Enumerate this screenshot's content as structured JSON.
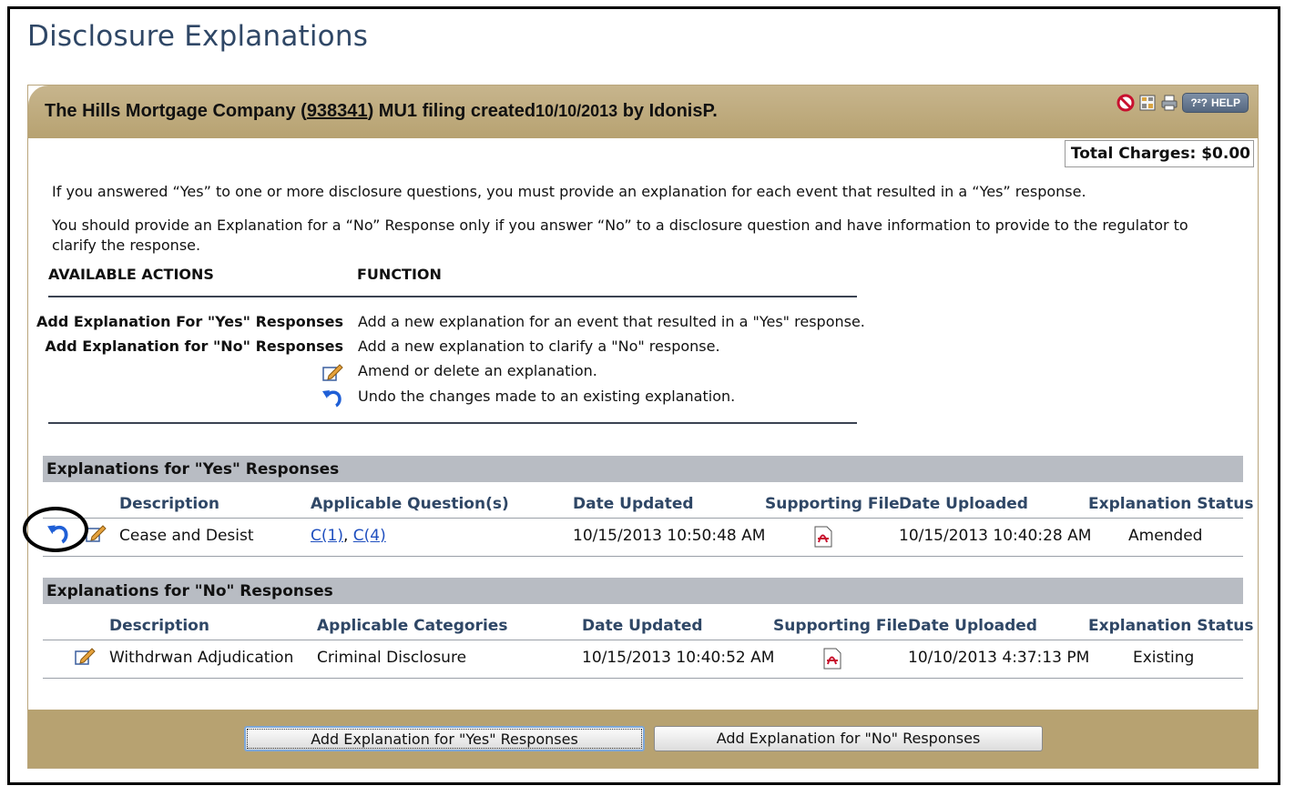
{
  "page_title": "Disclosure Explanations",
  "header": {
    "company_prefix": "The Hills Mortgage Company (",
    "filing_number": "938341",
    "company_suffix": ") MU1 filing created",
    "created_date": "10/10/2013",
    "created_by": " by IdonisP.",
    "help_label": "HELP",
    "help_glyph": "?²?",
    "icons": [
      "no-entry-icon",
      "grid-icon",
      "printer-icon"
    ]
  },
  "total_charges": "Total Charges: $0.00",
  "intro": {
    "line1": "If you answered “Yes” to one or more disclosure questions, you must provide an explanation for each event that resulted in a “Yes” response.",
    "line2": "You should provide an Explanation for a “No” Response only if you answer “No” to a disclosure question and have information to provide to the regulator to clarify the response."
  },
  "actions": {
    "col_actions": "AVAILABLE ACTIONS",
    "col_function": "FUNCTION",
    "rows": [
      {
        "label": "Add Explanation For \"Yes\" Responses",
        "desc": "Add a new explanation for an event that resulted in a \"Yes\" response."
      },
      {
        "label": "Add Explanation for \"No\" Responses",
        "desc": "Add a new explanation to clarify a \"No\" response."
      },
      {
        "icon": "edit-icon",
        "desc": "Amend or delete an explanation."
      },
      {
        "icon": "undo-icon",
        "desc": "Undo the changes made to an existing explanation."
      }
    ]
  },
  "yes_section": {
    "title": "Explanations for \"Yes\" Responses",
    "headers": [
      "Description",
      "Applicable Question(s)",
      "Date Updated",
      "Supporting File",
      "Date Uploaded",
      "Explanation Status"
    ],
    "rows": [
      {
        "description": "Cease and Desist",
        "question_1": "C(1)",
        "separator": ", ",
        "question_2": "C(4)",
        "date_updated": "10/15/2013 10:50:48 AM",
        "file_icon": "pdf-icon",
        "date_uploaded": "10/15/2013 10:40:28 AM",
        "status": "Amended"
      }
    ]
  },
  "no_section": {
    "title": "Explanations for \"No\" Responses",
    "headers": [
      "Description",
      "Applicable Categories",
      "Date Updated",
      "Supporting File",
      "Date Uploaded",
      "Explanation Status"
    ],
    "rows": [
      {
        "description": "Withdrwan Adjudication",
        "category": "Criminal Disclosure",
        "date_updated": "10/15/2013 10:40:52 AM",
        "file_icon": "pdf-icon",
        "date_uploaded": "10/10/2013 4:37:13 PM",
        "status": "Existing"
      }
    ]
  },
  "footer": {
    "add_yes_button": "Add Explanation for \"Yes\" Responses",
    "add_no_button": "Add Explanation for \"No\" Responses"
  },
  "colors": {
    "header_tan": "#b7a271",
    "section_gray": "#b8bcc3",
    "title_blue": "#2f4766",
    "link_blue": "#1f4fbf"
  }
}
